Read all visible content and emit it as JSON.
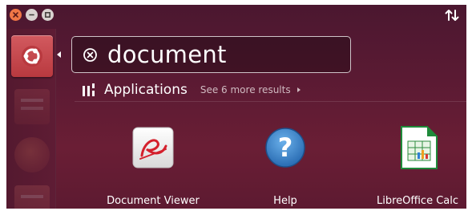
{
  "window": {
    "close_icon": "close-icon",
    "minimize_icon": "minimize-icon",
    "maximize_icon": "maximize-icon"
  },
  "launcher": {
    "items": [
      {
        "icon": "ubuntu-logo-icon",
        "active": true
      },
      {
        "icon": "files-icon"
      },
      {
        "icon": "firefox-icon"
      },
      {
        "icon": "writer-icon"
      }
    ]
  },
  "search": {
    "query": "document",
    "clear_icon": "clear-search-icon"
  },
  "category": {
    "title": "Applications",
    "more_results": "See 6 more results",
    "icon": "applications-icon"
  },
  "results": [
    {
      "label": "Document Viewer",
      "icon": "document-viewer-icon"
    },
    {
      "label": "Help",
      "icon": "help-icon"
    },
    {
      "label": "LibreOffice Calc",
      "icon": "libreoffice-calc-icon"
    }
  ],
  "colors": {
    "background": "#5a1a33",
    "accent": "#f07746",
    "dash_home": "#c2434a"
  }
}
